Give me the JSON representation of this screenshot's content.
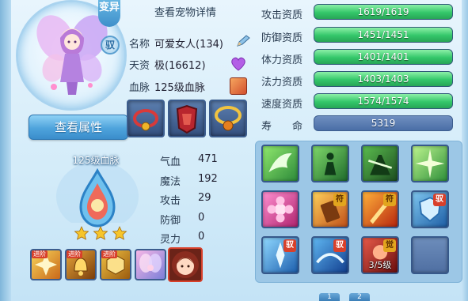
{
  "header": {
    "view_detail": "查看宠物详情",
    "variant_tag": "变异",
    "tame_tag": "驭"
  },
  "pet": {
    "name_label": "名称",
    "name_value": "可爱女人(134)",
    "aptitude_label": "天资",
    "aptitude_value": "极(16612)",
    "lineage_label": "血脉",
    "lineage_value": "125级血脉",
    "rename_icon": "pencil-icon",
    "favor_icon": "purple-heart-icon"
  },
  "buttons": {
    "view_attributes": "查看属性"
  },
  "equipment": [
    {
      "name": "necklace-red-icon"
    },
    {
      "name": "armor-red-icon"
    },
    {
      "name": "necklace-gold-icon"
    }
  ],
  "lineage_block": {
    "title": "125级血脉",
    "stars": 3
  },
  "stats": [
    {
      "label": "气血",
      "value": "471"
    },
    {
      "label": "魔法",
      "value": "192"
    },
    {
      "label": "攻击",
      "value": "29"
    },
    {
      "label": "防御",
      "value": "0"
    },
    {
      "label": "灵力",
      "value": "0"
    }
  ],
  "aptitudes": [
    {
      "label": "攻击资质",
      "text": "1619/1619",
      "fill": 1.0
    },
    {
      "label": "防御资质",
      "text": "1451/1451",
      "fill": 1.0
    },
    {
      "label": "体力资质",
      "text": "1401/1401",
      "fill": 1.0
    },
    {
      "label": "法力资质",
      "text": "1403/1403",
      "fill": 1.0
    },
    {
      "label": "速度资质",
      "text": "1574/1574",
      "fill": 1.0
    }
  ],
  "lifespan": {
    "label": "寿　　命",
    "value": "5319"
  },
  "skills": [
    {
      "name": "wing-skill-icon",
      "badge": ""
    },
    {
      "name": "silhouette-skill-icon",
      "badge": ""
    },
    {
      "name": "warrior-skill-icon",
      "badge": ""
    },
    {
      "name": "light-burst-skill-icon",
      "badge": ""
    },
    {
      "name": "flower-skill-icon",
      "badge": ""
    },
    {
      "name": "talisman-skill-icon",
      "badge": "符"
    },
    {
      "name": "fire-talisman-skill-icon",
      "badge": "符"
    },
    {
      "name": "shield-skill-icon",
      "badge": "驭"
    },
    {
      "name": "ice-crystal-skill-icon",
      "badge": "驭"
    },
    {
      "name": "ice-wave-skill-icon",
      "badge": "驭"
    },
    {
      "name": "awaken-skill-icon",
      "badge": "觉",
      "level": "3/5级"
    },
    {
      "name": "empty-skill-slot",
      "badge": ""
    }
  ],
  "bottom_skills": [
    {
      "name": "gold-burst-skill-icon",
      "badge": "进阶"
    },
    {
      "name": "bell-skill-icon",
      "badge": "进阶"
    },
    {
      "name": "hexagon-skill-icon",
      "badge": "进阶"
    },
    {
      "name": "fairy-skill-icon",
      "badge": ""
    },
    {
      "name": "portrait-skill-icon",
      "badge": ""
    }
  ],
  "pager": [
    "1",
    "2"
  ]
}
